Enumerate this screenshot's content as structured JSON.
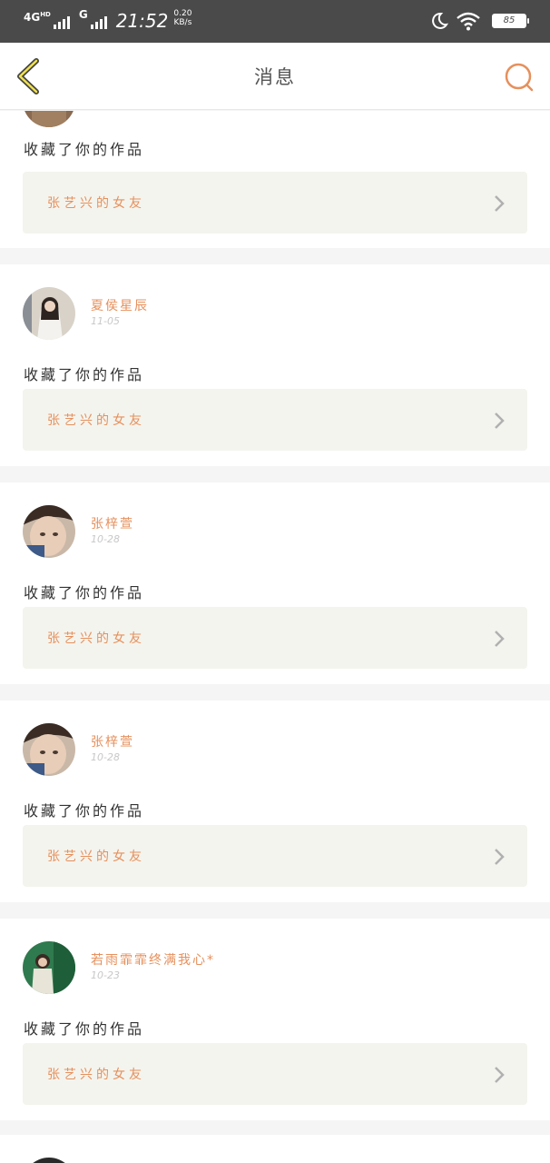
{
  "status_bar": {
    "network": "4G",
    "network_sub": "HD",
    "network2": "G",
    "time": "21:52",
    "speed_value": "0.20",
    "speed_unit": "KB/s",
    "battery": "85"
  },
  "nav": {
    "title": "消息"
  },
  "partial_top_item": {
    "action": "收藏了你的作品",
    "work_title": "张艺兴的女友"
  },
  "notifications": [
    {
      "user": "夏侯星辰",
      "date": "11-05",
      "action": "收藏了你的作品",
      "work_title": "张艺兴的女友"
    },
    {
      "user": "张梓萱",
      "date": "10-28",
      "action": "收藏了你的作品",
      "work_title": "张艺兴的女友"
    },
    {
      "user": "张梓萱",
      "date": "10-28",
      "action": "收藏了你的作品",
      "work_title": "张艺兴的女友"
    },
    {
      "user": "若雨霏霏终满我心*",
      "date": "10-23",
      "action": "收藏了你的作品",
      "work_title": "张艺兴的女友"
    }
  ],
  "colors": {
    "accent": "#e6905c",
    "status_bar_bg": "#4a4a4a",
    "work_card_bg": "#f4f4ee",
    "page_bg": "#f5f5f5"
  },
  "icons": {
    "back": "chevron-left-icon",
    "search": "search-icon",
    "moon": "moon-icon",
    "wifi": "wifi-icon",
    "chevron": "chevron-right-icon"
  }
}
